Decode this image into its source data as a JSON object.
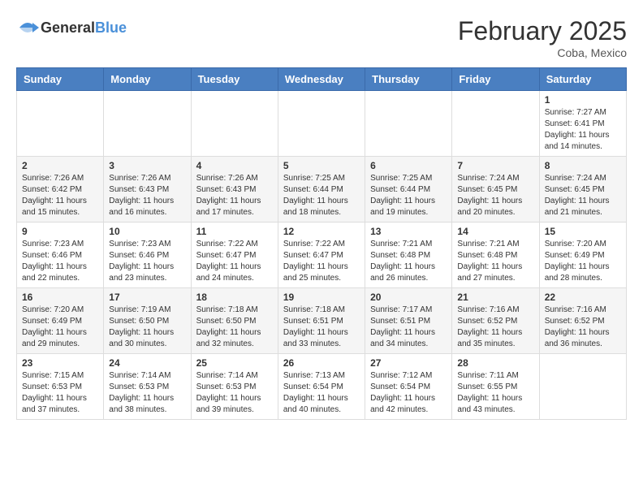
{
  "header": {
    "logo_general": "General",
    "logo_blue": "Blue",
    "month": "February 2025",
    "location": "Coba, Mexico"
  },
  "weekdays": [
    "Sunday",
    "Monday",
    "Tuesday",
    "Wednesday",
    "Thursday",
    "Friday",
    "Saturday"
  ],
  "weeks": [
    [
      {
        "day": "",
        "info": ""
      },
      {
        "day": "",
        "info": ""
      },
      {
        "day": "",
        "info": ""
      },
      {
        "day": "",
        "info": ""
      },
      {
        "day": "",
        "info": ""
      },
      {
        "day": "",
        "info": ""
      },
      {
        "day": "1",
        "info": "Sunrise: 7:27 AM\nSunset: 6:41 PM\nDaylight: 11 hours\nand 14 minutes."
      }
    ],
    [
      {
        "day": "2",
        "info": "Sunrise: 7:26 AM\nSunset: 6:42 PM\nDaylight: 11 hours\nand 15 minutes."
      },
      {
        "day": "3",
        "info": "Sunrise: 7:26 AM\nSunset: 6:43 PM\nDaylight: 11 hours\nand 16 minutes."
      },
      {
        "day": "4",
        "info": "Sunrise: 7:26 AM\nSunset: 6:43 PM\nDaylight: 11 hours\nand 17 minutes."
      },
      {
        "day": "5",
        "info": "Sunrise: 7:25 AM\nSunset: 6:44 PM\nDaylight: 11 hours\nand 18 minutes."
      },
      {
        "day": "6",
        "info": "Sunrise: 7:25 AM\nSunset: 6:44 PM\nDaylight: 11 hours\nand 19 minutes."
      },
      {
        "day": "7",
        "info": "Sunrise: 7:24 AM\nSunset: 6:45 PM\nDaylight: 11 hours\nand 20 minutes."
      },
      {
        "day": "8",
        "info": "Sunrise: 7:24 AM\nSunset: 6:45 PM\nDaylight: 11 hours\nand 21 minutes."
      }
    ],
    [
      {
        "day": "9",
        "info": "Sunrise: 7:23 AM\nSunset: 6:46 PM\nDaylight: 11 hours\nand 22 minutes."
      },
      {
        "day": "10",
        "info": "Sunrise: 7:23 AM\nSunset: 6:46 PM\nDaylight: 11 hours\nand 23 minutes."
      },
      {
        "day": "11",
        "info": "Sunrise: 7:22 AM\nSunset: 6:47 PM\nDaylight: 11 hours\nand 24 minutes."
      },
      {
        "day": "12",
        "info": "Sunrise: 7:22 AM\nSunset: 6:47 PM\nDaylight: 11 hours\nand 25 minutes."
      },
      {
        "day": "13",
        "info": "Sunrise: 7:21 AM\nSunset: 6:48 PM\nDaylight: 11 hours\nand 26 minutes."
      },
      {
        "day": "14",
        "info": "Sunrise: 7:21 AM\nSunset: 6:48 PM\nDaylight: 11 hours\nand 27 minutes."
      },
      {
        "day": "15",
        "info": "Sunrise: 7:20 AM\nSunset: 6:49 PM\nDaylight: 11 hours\nand 28 minutes."
      }
    ],
    [
      {
        "day": "16",
        "info": "Sunrise: 7:20 AM\nSunset: 6:49 PM\nDaylight: 11 hours\nand 29 minutes."
      },
      {
        "day": "17",
        "info": "Sunrise: 7:19 AM\nSunset: 6:50 PM\nDaylight: 11 hours\nand 30 minutes."
      },
      {
        "day": "18",
        "info": "Sunrise: 7:18 AM\nSunset: 6:50 PM\nDaylight: 11 hours\nand 32 minutes."
      },
      {
        "day": "19",
        "info": "Sunrise: 7:18 AM\nSunset: 6:51 PM\nDaylight: 11 hours\nand 33 minutes."
      },
      {
        "day": "20",
        "info": "Sunrise: 7:17 AM\nSunset: 6:51 PM\nDaylight: 11 hours\nand 34 minutes."
      },
      {
        "day": "21",
        "info": "Sunrise: 7:16 AM\nSunset: 6:52 PM\nDaylight: 11 hours\nand 35 minutes."
      },
      {
        "day": "22",
        "info": "Sunrise: 7:16 AM\nSunset: 6:52 PM\nDaylight: 11 hours\nand 36 minutes."
      }
    ],
    [
      {
        "day": "23",
        "info": "Sunrise: 7:15 AM\nSunset: 6:53 PM\nDaylight: 11 hours\nand 37 minutes."
      },
      {
        "day": "24",
        "info": "Sunrise: 7:14 AM\nSunset: 6:53 PM\nDaylight: 11 hours\nand 38 minutes."
      },
      {
        "day": "25",
        "info": "Sunrise: 7:14 AM\nSunset: 6:53 PM\nDaylight: 11 hours\nand 39 minutes."
      },
      {
        "day": "26",
        "info": "Sunrise: 7:13 AM\nSunset: 6:54 PM\nDaylight: 11 hours\nand 40 minutes."
      },
      {
        "day": "27",
        "info": "Sunrise: 7:12 AM\nSunset: 6:54 PM\nDaylight: 11 hours\nand 42 minutes."
      },
      {
        "day": "28",
        "info": "Sunrise: 7:11 AM\nSunset: 6:55 PM\nDaylight: 11 hours\nand 43 minutes."
      },
      {
        "day": "",
        "info": ""
      }
    ]
  ]
}
